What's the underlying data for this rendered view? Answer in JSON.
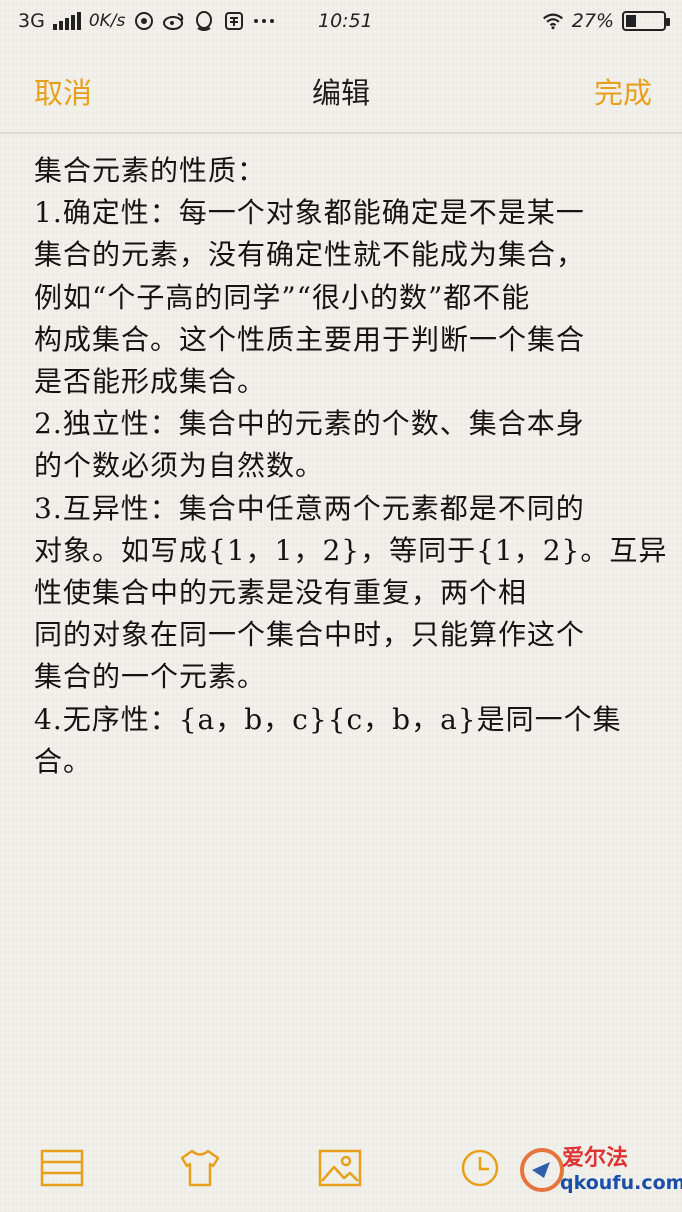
{
  "status_bar": {
    "network": "3G",
    "speed": "0K/s",
    "time": "10:51",
    "battery": "27%",
    "battery_level": 0.27
  },
  "nav": {
    "cancel_label": "取消",
    "title": "编辑",
    "done_label": "完成",
    "accent_color": "#e6a01c"
  },
  "note": {
    "lines": [
      "集合元素的性质：",
      "1.确定性：每一个对象都能确定是不是某一",
      "集合的元素，没有确定性就不能成为集合，",
      "例如“个子高的同学”“很小的数”都不能",
      "构成集合。这个性质主要用于判断一个集合",
      "是否能形成集合。",
      "2.独立性：集合中的元素的个数、集合本身",
      "的个数必须为自然数。",
      "3.互异性：集合中任意两个元素都是不同的",
      "对象。如写成{1，1，2}，等同于{1，2}。互异",
      "性使集合中的元素是没有重复，两个相",
      "同的对象在同一个集合中时，只能算作这个",
      "集合的一个元素。",
      "4.无序性：{a，b，c}{c，b，a}是同一个集",
      "合。"
    ]
  },
  "toolbar": {
    "icons": [
      "list-icon",
      "shirt-icon",
      "image-icon",
      "clock-icon"
    ]
  },
  "watermark": {
    "line1": "爱尔法",
    "line2": "qkoufu.com"
  }
}
